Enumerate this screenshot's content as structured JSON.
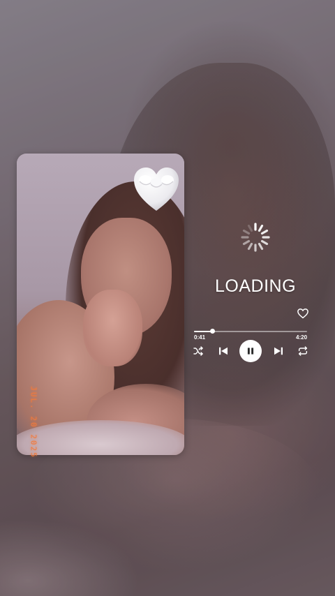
{
  "story": {
    "loading_label": "LOADING",
    "date_stamp": "JUL. 20 2025"
  },
  "player": {
    "elapsed": "0:41",
    "total": "4:20",
    "progress_fraction": 0.16,
    "icons": [
      "heart-outline-icon",
      "shuffle-icon",
      "previous-icon",
      "pause-icon",
      "next-icon",
      "repeat-icon",
      "loading-spinner-icon"
    ]
  },
  "colors": {
    "accent": "#ffffff",
    "date_stamp": "#f07a3c",
    "heart_emoji": "#f4f4f6"
  }
}
